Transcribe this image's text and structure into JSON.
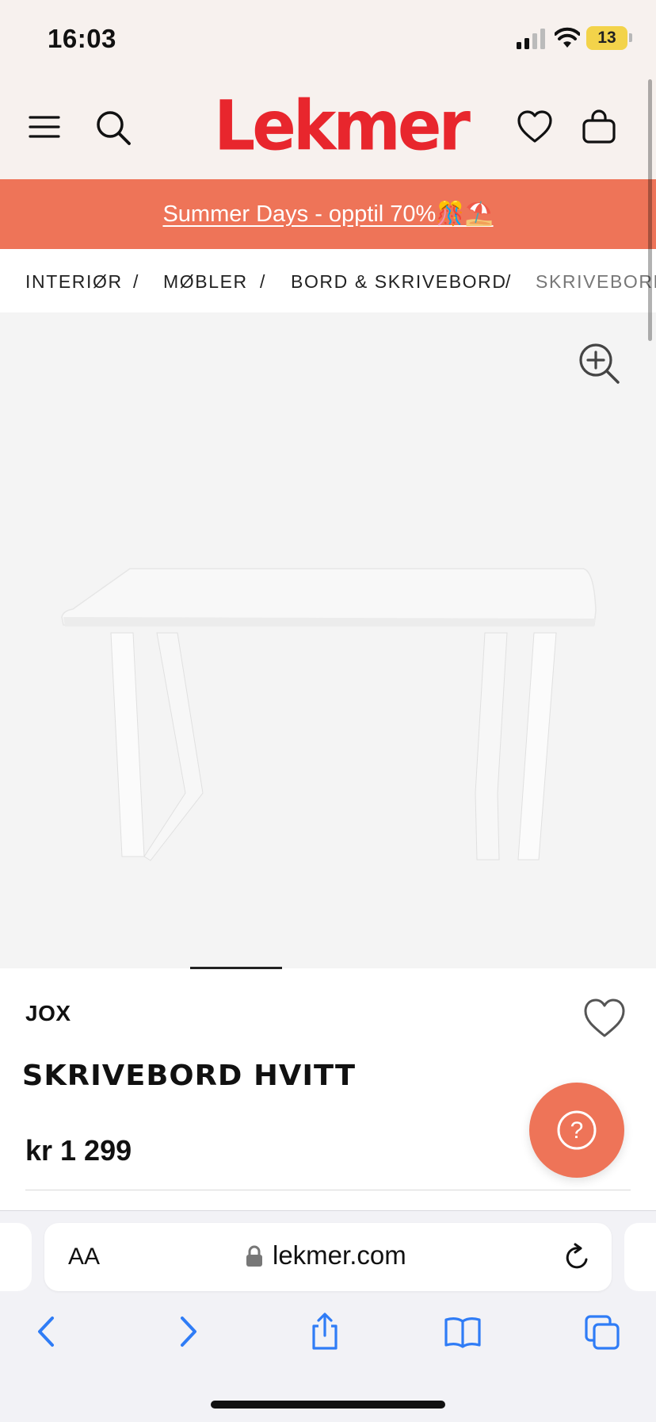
{
  "status_bar": {
    "time": "16:03",
    "battery": "13"
  },
  "header": {
    "logo": "Lekmer"
  },
  "promo": {
    "text": "Summer Days - opptil 70%🎊⛱️"
  },
  "breadcrumb": {
    "items": [
      "INTERIØR",
      "MØBLER",
      "BORD & SKRIVEBORD",
      "SKRIVEBORD"
    ],
    "separator": "/"
  },
  "product": {
    "brand": "JOX",
    "title": "SKRIVEBORD HVITT",
    "price": "kr 1 299"
  },
  "help_button": {
    "label": "?"
  },
  "browser": {
    "text_size_label": "AA",
    "url": "lekmer.com"
  },
  "colors": {
    "brand_red": "#e8262d",
    "promo_orange": "#ee7458",
    "header_bg": "#f7f1ee"
  },
  "icons": [
    "menu-icon",
    "search-icon",
    "heart-icon",
    "bag-icon",
    "zoom-icon",
    "lock-icon",
    "reload-icon",
    "back-icon",
    "forward-icon",
    "share-icon",
    "bookmarks-icon",
    "tabs-icon"
  ]
}
